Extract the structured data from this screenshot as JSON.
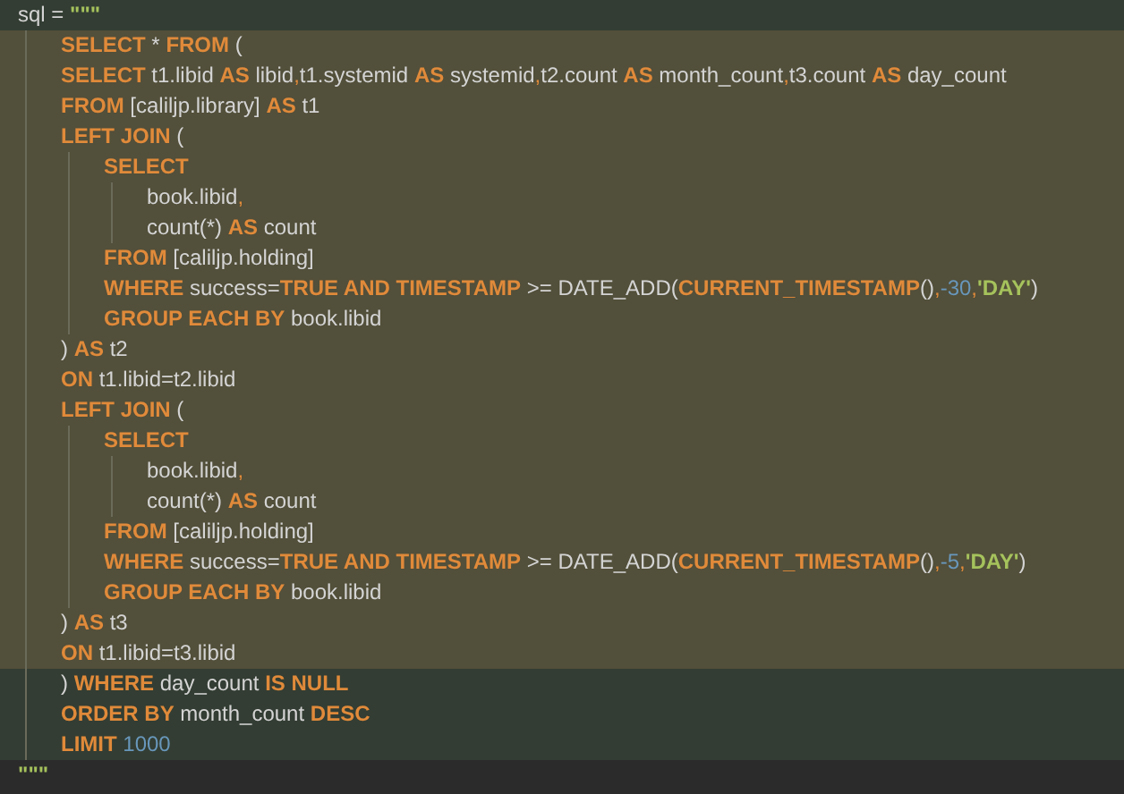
{
  "editor": {
    "lines": [
      {
        "kind": "host",
        "tokens": [
          {
            "kind": "plain",
            "text": "sql = "
          },
          {
            "kind": "string",
            "text": "\"\"\""
          }
        ],
        "children": [
          {
            "kind": "injected",
            "tokens": [
              {
                "kind": "keyword",
                "text": "SELECT"
              },
              {
                "kind": "plain",
                "text": " * "
              },
              {
                "kind": "keyword",
                "text": "FROM"
              },
              {
                "kind": "plain",
                "text": " ("
              }
            ]
          },
          {
            "kind": "injected",
            "tokens": [
              {
                "kind": "keyword",
                "text": "SELECT"
              },
              {
                "kind": "plain",
                "text": " t1.libid "
              },
              {
                "kind": "keyword",
                "text": "AS"
              },
              {
                "kind": "plain",
                "text": " libid"
              },
              {
                "kind": "punct",
                "text": ","
              },
              {
                "kind": "plain",
                "text": "t1.systemid "
              },
              {
                "kind": "keyword",
                "text": "AS"
              },
              {
                "kind": "plain",
                "text": " systemid"
              },
              {
                "kind": "punct",
                "text": ","
              },
              {
                "kind": "plain",
                "text": "t2.count "
              },
              {
                "kind": "keyword",
                "text": "AS"
              },
              {
                "kind": "plain",
                "text": " month_count"
              },
              {
                "kind": "punct",
                "text": ","
              },
              {
                "kind": "plain",
                "text": "t3.count "
              },
              {
                "kind": "keyword",
                "text": "AS"
              },
              {
                "kind": "plain",
                "text": " day_count"
              }
            ]
          },
          {
            "kind": "injected",
            "tokens": [
              {
                "kind": "keyword",
                "text": "FROM"
              },
              {
                "kind": "plain",
                "text": " [caliljp.library] "
              },
              {
                "kind": "keyword",
                "text": "AS"
              },
              {
                "kind": "plain",
                "text": " t1"
              }
            ]
          },
          {
            "kind": "injected",
            "tokens": [
              {
                "kind": "keyword",
                "text": "LEFT JOIN"
              },
              {
                "kind": "plain",
                "text": " ("
              }
            ],
            "children": [
              {
                "kind": "injected",
                "tokens": [
                  {
                    "kind": "keyword",
                    "text": "SELECT"
                  }
                ],
                "children": [
                  {
                    "kind": "injected",
                    "tokens": [
                      {
                        "kind": "plain",
                        "text": "book.libid"
                      },
                      {
                        "kind": "punct",
                        "text": ","
                      }
                    ]
                  },
                  {
                    "kind": "injected",
                    "tokens": [
                      {
                        "kind": "plain",
                        "text": "count(*) "
                      },
                      {
                        "kind": "keyword",
                        "text": "AS"
                      },
                      {
                        "kind": "plain",
                        "text": " count"
                      }
                    ]
                  }
                ]
              },
              {
                "kind": "injected",
                "tokens": [
                  {
                    "kind": "keyword",
                    "text": "FROM"
                  },
                  {
                    "kind": "plain",
                    "text": " [caliljp.holding]"
                  }
                ]
              },
              {
                "kind": "injected",
                "tokens": [
                  {
                    "kind": "keyword",
                    "text": "WHERE"
                  },
                  {
                    "kind": "plain",
                    "text": " success="
                  },
                  {
                    "kind": "keyword",
                    "text": "TRUE AND TIMESTAMP"
                  },
                  {
                    "kind": "plain",
                    "text": " >= DATE_ADD("
                  },
                  {
                    "kind": "keyword",
                    "text": "CURRENT_TIMESTAMP"
                  },
                  {
                    "kind": "plain",
                    "text": "()"
                  },
                  {
                    "kind": "punct",
                    "text": ","
                  },
                  {
                    "kind": "number",
                    "text": "-30"
                  },
                  {
                    "kind": "punct",
                    "text": ","
                  },
                  {
                    "kind": "string",
                    "text": "'DAY'"
                  },
                  {
                    "kind": "plain",
                    "text": ")"
                  }
                ]
              },
              {
                "kind": "injected",
                "tokens": [
                  {
                    "kind": "keyword",
                    "text": "GROUP EACH BY"
                  },
                  {
                    "kind": "plain",
                    "text": " book.libid"
                  }
                ]
              }
            ]
          },
          {
            "kind": "injected",
            "tokens": [
              {
                "kind": "plain",
                "text": ") "
              },
              {
                "kind": "keyword",
                "text": "AS"
              },
              {
                "kind": "plain",
                "text": " t2"
              }
            ]
          },
          {
            "kind": "injected",
            "tokens": [
              {
                "kind": "keyword",
                "text": "ON"
              },
              {
                "kind": "plain",
                "text": " t1.libid=t2.libid"
              }
            ]
          },
          {
            "kind": "injected",
            "tokens": [
              {
                "kind": "keyword",
                "text": "LEFT JOIN"
              },
              {
                "kind": "plain",
                "text": " ("
              }
            ],
            "children": [
              {
                "kind": "injected",
                "tokens": [
                  {
                    "kind": "keyword",
                    "text": "SELECT"
                  }
                ],
                "children": [
                  {
                    "kind": "injected",
                    "tokens": [
                      {
                        "kind": "plain",
                        "text": "book.libid"
                      },
                      {
                        "kind": "punct",
                        "text": ","
                      }
                    ]
                  },
                  {
                    "kind": "injected",
                    "tokens": [
                      {
                        "kind": "plain",
                        "text": "count(*) "
                      },
                      {
                        "kind": "keyword",
                        "text": "AS"
                      },
                      {
                        "kind": "plain",
                        "text": " count"
                      }
                    ]
                  }
                ]
              },
              {
                "kind": "injected",
                "tokens": [
                  {
                    "kind": "keyword",
                    "text": "FROM"
                  },
                  {
                    "kind": "plain",
                    "text": " [caliljp.holding]"
                  }
                ]
              },
              {
                "kind": "injected",
                "tokens": [
                  {
                    "kind": "keyword",
                    "text": "WHERE"
                  },
                  {
                    "kind": "plain",
                    "text": " success="
                  },
                  {
                    "kind": "keyword",
                    "text": "TRUE AND TIMESTAMP"
                  },
                  {
                    "kind": "plain",
                    "text": " >= DATE_ADD("
                  },
                  {
                    "kind": "keyword",
                    "text": "CURRENT_TIMESTAMP"
                  },
                  {
                    "kind": "plain",
                    "text": "()"
                  },
                  {
                    "kind": "punct",
                    "text": ","
                  },
                  {
                    "kind": "number",
                    "text": "-5"
                  },
                  {
                    "kind": "punct",
                    "text": ","
                  },
                  {
                    "kind": "string",
                    "text": "'DAY'"
                  },
                  {
                    "kind": "plain",
                    "text": ")"
                  }
                ]
              },
              {
                "kind": "injected",
                "tokens": [
                  {
                    "kind": "keyword",
                    "text": "GROUP EACH BY"
                  },
                  {
                    "kind": "plain",
                    "text": " book.libid"
                  }
                ]
              }
            ]
          },
          {
            "kind": "injected",
            "tokens": [
              {
                "kind": "plain",
                "text": ") "
              },
              {
                "kind": "keyword",
                "text": "AS"
              },
              {
                "kind": "plain",
                "text": " t3"
              }
            ]
          },
          {
            "kind": "injected",
            "tokens": [
              {
                "kind": "keyword",
                "text": "ON"
              },
              {
                "kind": "plain",
                "text": " t1.libid=t3.libid"
              }
            ]
          },
          {
            "kind": "host",
            "tokens": [
              {
                "kind": "plain",
                "text": ") "
              },
              {
                "kind": "keyword",
                "text": "WHERE"
              },
              {
                "kind": "plain",
                "text": " day_count "
              },
              {
                "kind": "keyword",
                "text": "IS NULL"
              }
            ]
          },
          {
            "kind": "host",
            "tokens": [
              {
                "kind": "keyword",
                "text": "ORDER BY"
              },
              {
                "kind": "plain",
                "text": " month_count "
              },
              {
                "kind": "keyword",
                "text": "DESC"
              }
            ]
          },
          {
            "kind": "host",
            "tokens": [
              {
                "kind": "keyword",
                "text": "LIMIT"
              },
              {
                "kind": "number",
                "text": " 1000"
              }
            ]
          }
        ]
      },
      {
        "kind": "caret",
        "tokens": [
          {
            "kind": "string",
            "text": "\"\"\""
          }
        ]
      }
    ]
  }
}
